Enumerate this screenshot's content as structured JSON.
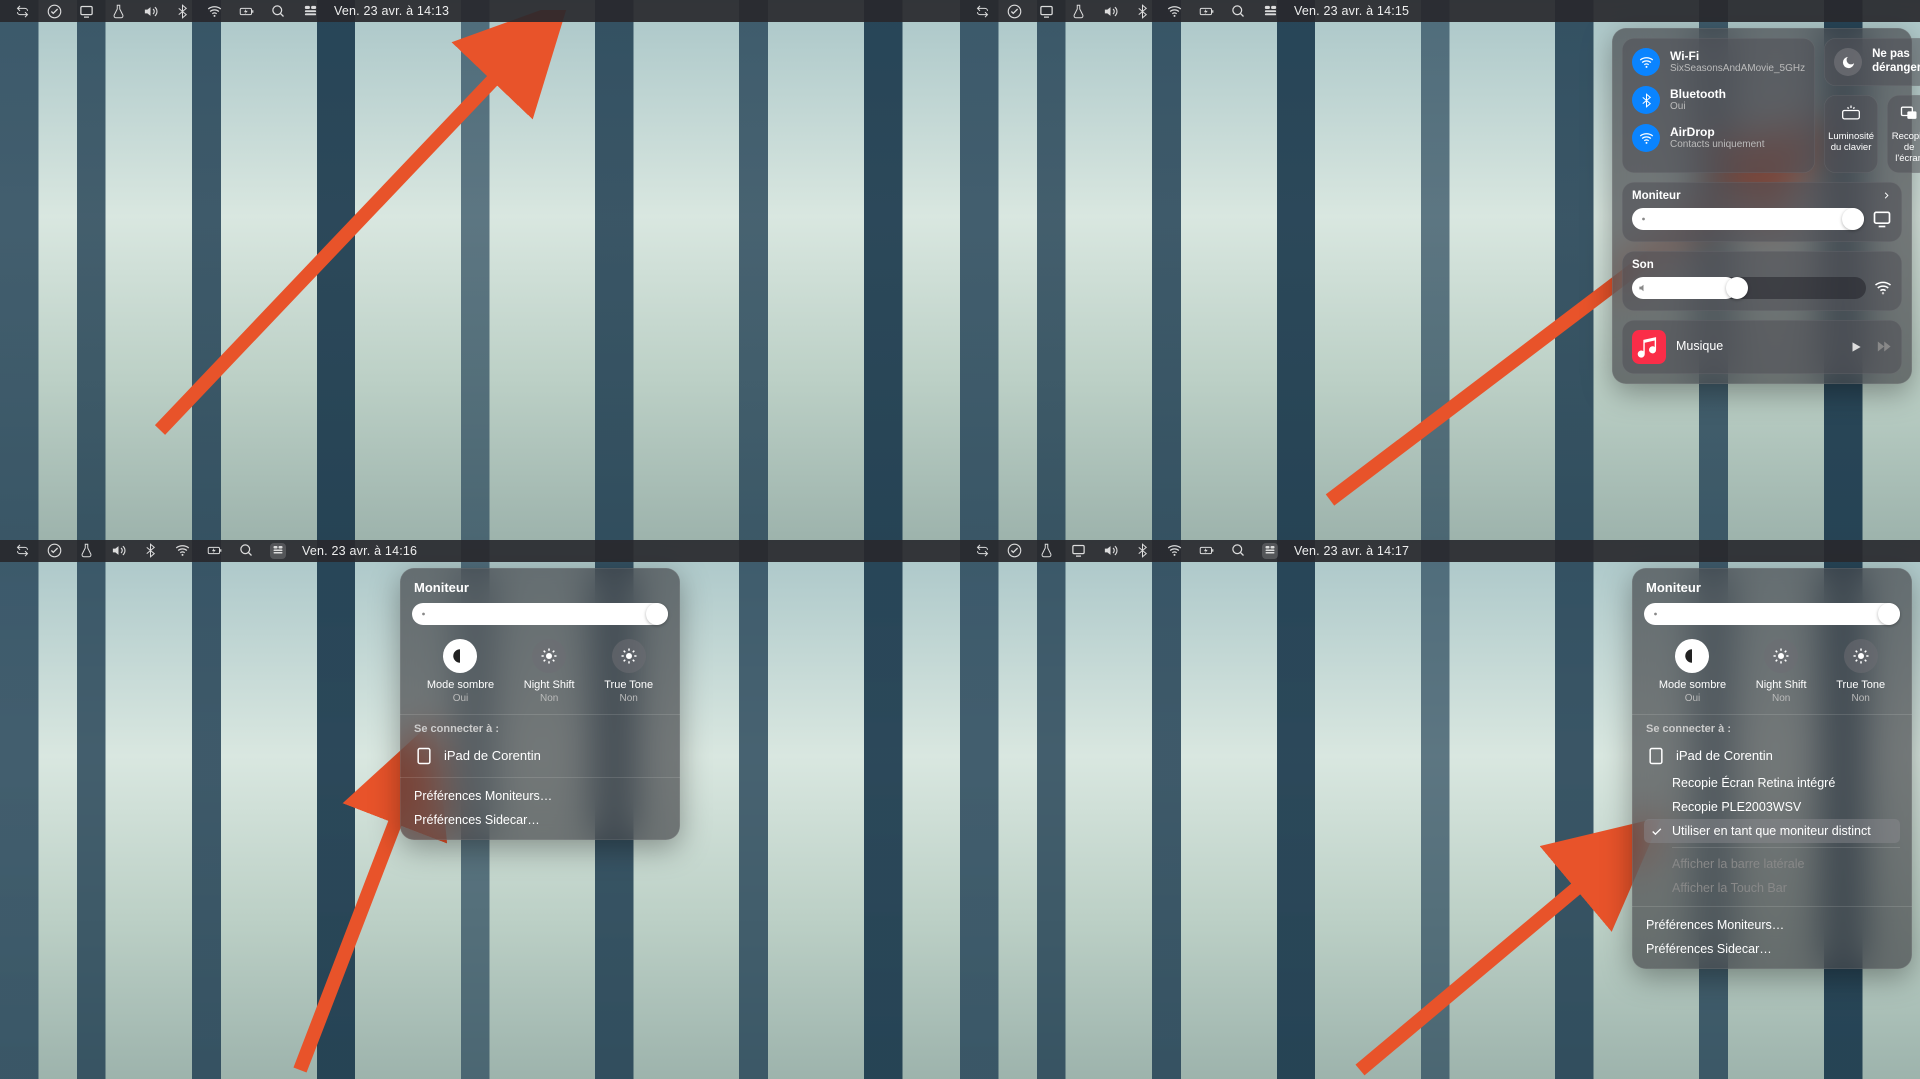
{
  "q1": {
    "clock": "Ven. 23 avr. à  14:13"
  },
  "q2": {
    "clock": "Ven. 23 avr. à  14:15",
    "wifi_title": "Wi-Fi",
    "wifi_sub": "SixSeasonsAndAMovie_5GHz",
    "bt_title": "Bluetooth",
    "bt_sub": "Oui",
    "ad_title": "AirDrop",
    "ad_sub": "Contacts uniquement",
    "dnd_title": "Ne pas déranger",
    "kbbright": "Luminosité du clavier",
    "mirror": "Recopie de l'écran",
    "moniteur": "Moniteur",
    "son": "Son",
    "music": "Musique"
  },
  "q3": {
    "clock": "Ven. 23 avr. à  14:16",
    "hdr": "Moniteur",
    "dark_t": "Mode sombre",
    "dark_s": "Oui",
    "ns_t": "Night Shift",
    "ns_s": "Non",
    "tt_t": "True Tone",
    "tt_s": "Non",
    "connect": "Se connecter à :",
    "ipad": "iPad de Corentin",
    "pref_mon": "Préférences Moniteurs…",
    "pref_side": "Préférences Sidecar…"
  },
  "q4": {
    "clock": "Ven. 23 avr. à  14:17",
    "hdr": "Moniteur",
    "dark_t": "Mode sombre",
    "dark_s": "Oui",
    "ns_t": "Night Shift",
    "ns_s": "Non",
    "tt_t": "True Tone",
    "tt_s": "Non",
    "connect": "Se connecter à :",
    "ipad": "iPad de Corentin",
    "opt1": "Recopie Écran Retina intégré",
    "opt2": "Recopie PLE2003WSV",
    "opt3": "Utiliser en tant que moniteur distinct",
    "opt4": "Afficher la barre latérale",
    "opt5": "Afficher la Touch Bar",
    "pref_mon": "Préférences Moniteurs…",
    "pref_side": "Préférences Sidecar…"
  }
}
